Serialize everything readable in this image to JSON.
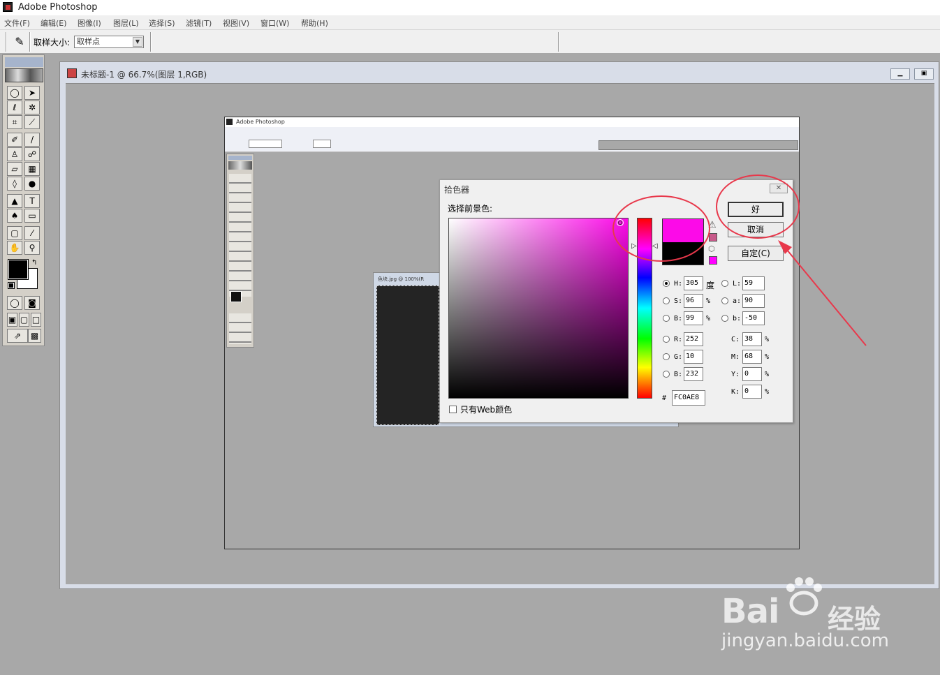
{
  "app": {
    "title": "Adobe Photoshop",
    "menu": [
      "文件(F)",
      "编辑(E)",
      "图像(I)",
      "图层(L)",
      "选择(S)",
      "滤镜(T)",
      "视图(V)",
      "窗口(W)",
      "帮助(H)"
    ]
  },
  "options_bar": {
    "sample_size_label": "取样大小:",
    "sample_size_value": "取样点"
  },
  "document": {
    "title": "未标题-1 @ 66.7%(图层 1,RGB)"
  },
  "inner_screenshot": {
    "title": "Adobe Photoshop",
    "doc_label": "色块.jpg @ 100%(R"
  },
  "color_picker": {
    "title": "拾色器",
    "prompt": "选择前景色:",
    "ok_label": "好",
    "cancel_label": "取消",
    "custom_label": "自定(C)",
    "web_only_label": "只有Web颜色",
    "degree_unit": "度",
    "percent_unit": "%",
    "hash_label": "#",
    "hsb": {
      "h_label": "H:",
      "h": "305",
      "s_label": "S:",
      "s": "96",
      "b_label": "B:",
      "b": "99"
    },
    "rgb": {
      "r_label": "R:",
      "r": "252",
      "g_label": "G:",
      "g": "10",
      "b_label": "B:",
      "b": "232"
    },
    "lab": {
      "l_label": "L:",
      "l": "59",
      "a_label": "a:",
      "a": "90",
      "b_label": "b:",
      "b": "-50"
    },
    "cmyk": {
      "c_label": "C:",
      "c": "38",
      "m_label": "M:",
      "m": "68",
      "y_label": "Y:",
      "y": "0",
      "k_label": "K:",
      "k": "0"
    },
    "hex": "FC0AE8",
    "selected_mode": "H",
    "new_color": "#fc0ae8",
    "old_color": "#000000"
  },
  "watermark": {
    "brand": "Bai",
    "brand_cn": "经验",
    "url": "jingyan.baidu.com"
  },
  "colors": {
    "annotation_red": "#e8384b",
    "workspace_gray": "#a8a8a8"
  }
}
